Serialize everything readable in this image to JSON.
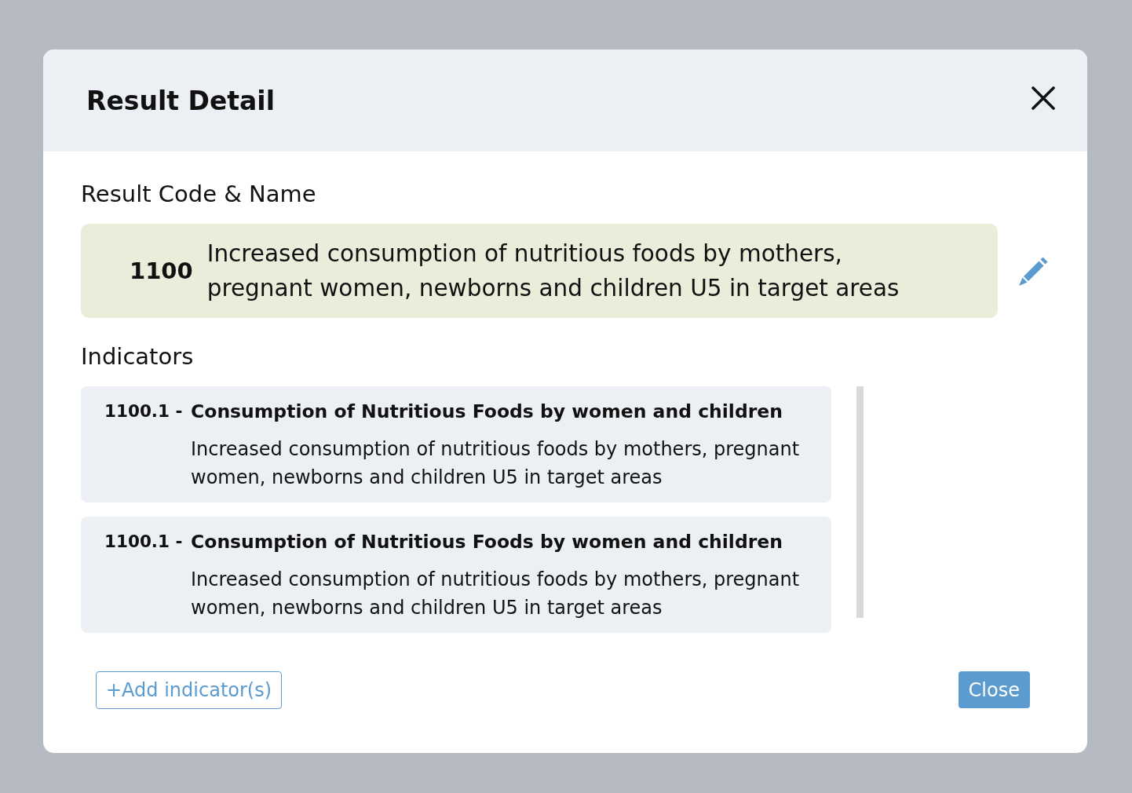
{
  "window": {
    "title": "Result Detail"
  },
  "result": {
    "heading": "Result Code & Name",
    "code": "1100",
    "name": "Increased consumption of nutritious foods by mothers, pregnant women, newborns and children U5 in target areas"
  },
  "indicators": {
    "heading": "Indicators",
    "items": [
      {
        "code": "1100.1 -",
        "title": "Consumption of Nutritious Foods by women and children",
        "description": "Increased consumption of nutritious foods by mothers, pregnant women, newborns and children U5 in target areas"
      },
      {
        "code": "1100.1 -",
        "title": "Consumption of Nutritious Foods by women and children",
        "description": "Increased consumption of nutritious foods by mothers, pregnant women, newborns and children U5 in target areas"
      }
    ]
  },
  "buttons": [
    {
      "label": "+Add indicator(s)",
      "kind": "outline"
    },
    {
      "label": "Close",
      "kind": "primary"
    }
  ]
}
